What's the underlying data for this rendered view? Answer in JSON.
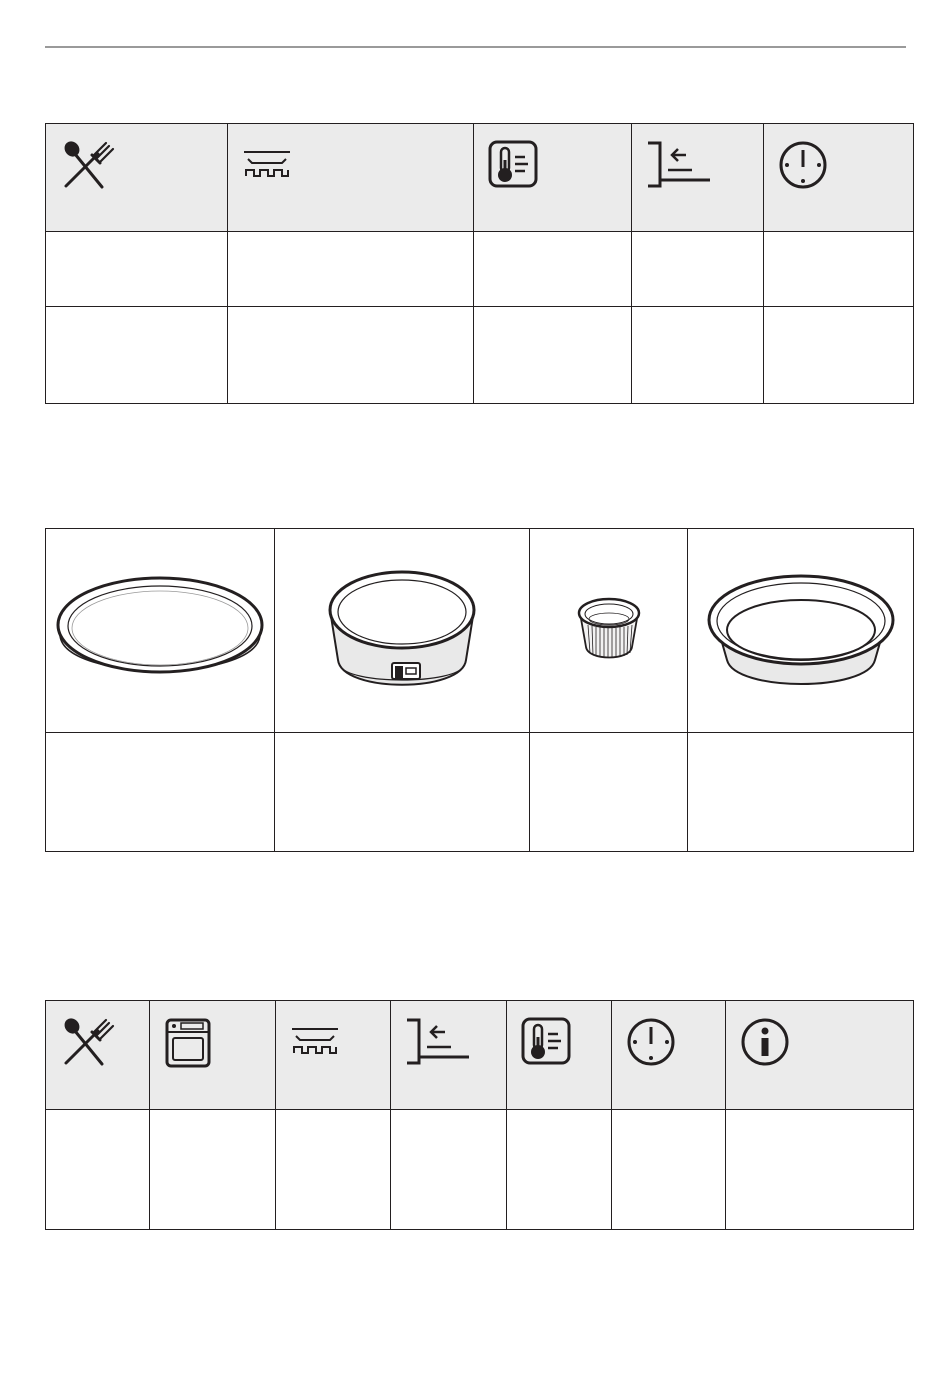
{
  "page": {
    "rule_color": "#9a9a9a",
    "header_bg": "#ebebeb"
  },
  "table_1": {
    "header_icons": [
      "cutlery-icon",
      "tray-icon",
      "temperature-icon",
      "shelf-level-icon",
      "time-icon"
    ],
    "rows": [
      [
        "",
        "",
        "",
        "",
        ""
      ],
      [
        "",
        "",
        "",
        "",
        ""
      ]
    ]
  },
  "table_2": {
    "images": [
      "flan-base-tin-illustration",
      "springform-tin-illustration",
      "ramekin-illustration",
      "deep-pie-dish-illustration"
    ],
    "labels": [
      "",
      "",
      "",
      ""
    ]
  },
  "table_3": {
    "header_icons": [
      "cutlery-icon",
      "oven-function-icon",
      "tray-icon",
      "shelf-level-icon",
      "temperature-icon",
      "time-icon",
      "info-icon"
    ],
    "rows": [
      [
        "",
        "",
        "",
        "",
        "",
        "",
        ""
      ]
    ]
  }
}
